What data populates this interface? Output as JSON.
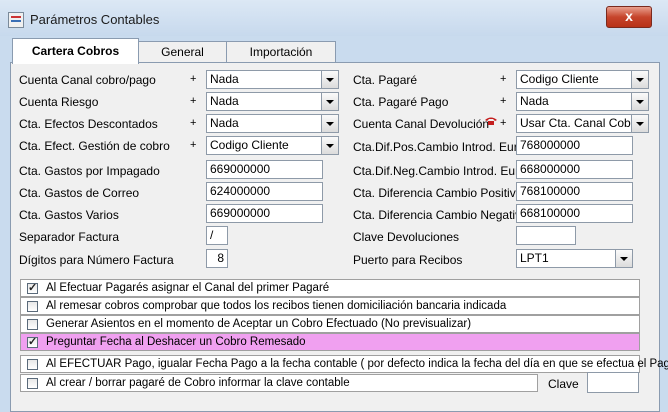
{
  "window": {
    "title": "Parámetros Contables",
    "close_label": "x"
  },
  "tabs": [
    {
      "label": "Cartera Cobros",
      "active": true
    },
    {
      "label": "General",
      "active": false
    },
    {
      "label": "Importación",
      "active": false
    }
  ],
  "left_rows": [
    {
      "label": "Cuenta Canal cobro/pago",
      "plus": "+",
      "value": "Nada"
    },
    {
      "label": "Cuenta Riesgo",
      "plus": "+",
      "value": "Nada"
    },
    {
      "label": "Cta. Efectos Descontados",
      "plus": "+",
      "value": "Nada"
    },
    {
      "label": "Cta. Efect. Gestión de cobro",
      "plus": "+",
      "value": "Codigo Cliente"
    },
    {
      "label": "Cta. Gastos por Impagado",
      "value": "669000000"
    },
    {
      "label": "Cta. Gastos de Correo",
      "value": "624000000"
    },
    {
      "label": "Cta. Gastos Varios",
      "value": "669000000"
    },
    {
      "label": "Separador Factura",
      "value": "/"
    },
    {
      "label": "Dígitos para Número Factura",
      "value": "8"
    }
  ],
  "right_rows": [
    {
      "label": "Cta. Pagaré",
      "plus": "+",
      "value": "Codigo Cliente"
    },
    {
      "label": "Cta. Pagaré Pago",
      "plus": "+",
      "value": "Nada"
    },
    {
      "label": "Cuenta Canal Devolución",
      "plus": "+",
      "value": "Usar Cta. Canal Cobro"
    },
    {
      "label": "Cta.Dif.Pos.Cambio Introd. Euro",
      "value": "768000000"
    },
    {
      "label": "Cta.Dif.Neg.Cambio Introd. Euro",
      "value": "668000000"
    },
    {
      "label": "Cta. Diferencia Cambio Positiva",
      "value": "768100000"
    },
    {
      "label": "Cta. Diferencia Cambio Negativa",
      "value": "668100000"
    },
    {
      "label": "Clave Devoluciones",
      "value": ""
    },
    {
      "label": "Puerto para Recibos",
      "value": "LPT1"
    }
  ],
  "options": [
    {
      "label": "Al Efectuar Pagarés asignar el Canal del primer Pagaré",
      "checked": true
    },
    {
      "label": "Al remesar cobros comprobar que todos los recibos tienen domiciliación bancaria indicada",
      "checked": false
    },
    {
      "label": "Generar Asientos en el momento de Aceptar un Cobro Efectuado (No previsualizar)",
      "checked": false
    },
    {
      "label": "Preguntar Fecha al Deshacer un Cobro Remesado",
      "checked": true,
      "highlight": "#f0a0f0"
    },
    {
      "label": "Al EFECTUAR Pago, igualar Fecha Pago a la fecha contable ( por defecto indica la fecha del día en que se efectua el Pago",
      "checked": false
    },
    {
      "label": "Al crear / borrar pagaré de Cobro informar la clave contable",
      "checked": false
    }
  ],
  "clave": {
    "label": "Clave",
    "value": ""
  }
}
